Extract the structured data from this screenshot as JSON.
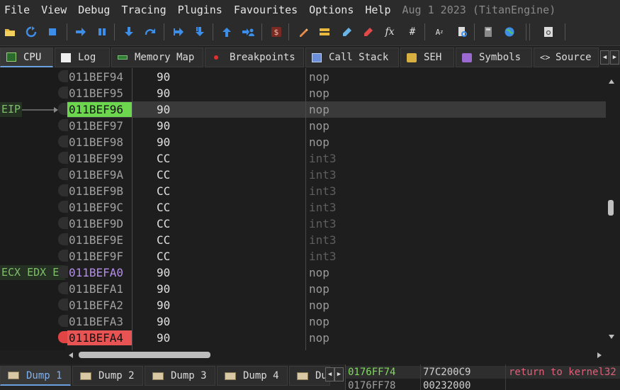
{
  "menu": {
    "items": [
      "File",
      "View",
      "Debug",
      "Tracing",
      "Plugins",
      "Favourites",
      "Options",
      "Help"
    ],
    "build_info": "Aug 1 2023 (TitanEngine)"
  },
  "toolbar": {
    "icons": [
      "open-icon",
      "restart-icon",
      "stop-icon",
      "run-icon",
      "pause-icon",
      "step-into-icon",
      "step-over-icon",
      "trace-into-icon",
      "trace-over-icon",
      "execute-till-return-icon",
      "run-to-user-code-icon",
      "scylla-icon",
      "patches-icon",
      "comments-icon",
      "labels-icon",
      "bookmarks-icon",
      "functions-icon",
      "hash-icon",
      "font-icon",
      "search-icon",
      "calculator-icon",
      "globe-icon",
      "about-icon"
    ]
  },
  "tabs": {
    "cpu": "CPU",
    "log": "Log",
    "memory_map": "Memory Map",
    "breakpoints": "Breakpoints",
    "call_stack": "Call Stack",
    "seh": "SEH",
    "symbols": "Symbols",
    "source": "Source"
  },
  "gutter": {
    "eip_label": "EIP",
    "reg_label": "ECX EDX E"
  },
  "disasm": {
    "rows": [
      {
        "addr": "011BEF94",
        "bytes": "90",
        "instr": "nop"
      },
      {
        "addr": "011BEF95",
        "bytes": "90",
        "instr": "nop"
      },
      {
        "addr": "011BEF96",
        "bytes": "90",
        "instr": "nop"
      },
      {
        "addr": "011BEF97",
        "bytes": "90",
        "instr": "nop"
      },
      {
        "addr": "011BEF98",
        "bytes": "90",
        "instr": "nop"
      },
      {
        "addr": "011BEF99",
        "bytes": "CC",
        "instr": "int3"
      },
      {
        "addr": "011BEF9A",
        "bytes": "CC",
        "instr": "int3"
      },
      {
        "addr": "011BEF9B",
        "bytes": "CC",
        "instr": "int3"
      },
      {
        "addr": "011BEF9C",
        "bytes": "CC",
        "instr": "int3"
      },
      {
        "addr": "011BEF9D",
        "bytes": "CC",
        "instr": "int3"
      },
      {
        "addr": "011BEF9E",
        "bytes": "CC",
        "instr": "int3"
      },
      {
        "addr": "011BEF9F",
        "bytes": "CC",
        "instr": "int3"
      },
      {
        "addr": "011BEFA0",
        "bytes": "90",
        "instr": "nop"
      },
      {
        "addr": "011BEFA1",
        "bytes": "90",
        "instr": "nop"
      },
      {
        "addr": "011BEFA2",
        "bytes": "90",
        "instr": "nop"
      },
      {
        "addr": "011BEFA3",
        "bytes": "90",
        "instr": "nop"
      },
      {
        "addr": "011BEFA4",
        "bytes": "90",
        "instr": "nop"
      }
    ]
  },
  "dump_tabs": [
    "Dump 1",
    "Dump 2",
    "Dump 3",
    "Dump 4",
    "Du"
  ],
  "stack": {
    "rows": [
      {
        "addr": "0176FF74",
        "value": "77C200C9",
        "comment": "return to kernel32"
      },
      {
        "addr": "0176FF78",
        "value": "00232000",
        "comment": ""
      }
    ]
  },
  "colors": {
    "eip_highlight": "#6cd64e",
    "breakpoint": "#e85353",
    "register_addr": "#b48ee8",
    "return_comment": "#e0607a"
  }
}
